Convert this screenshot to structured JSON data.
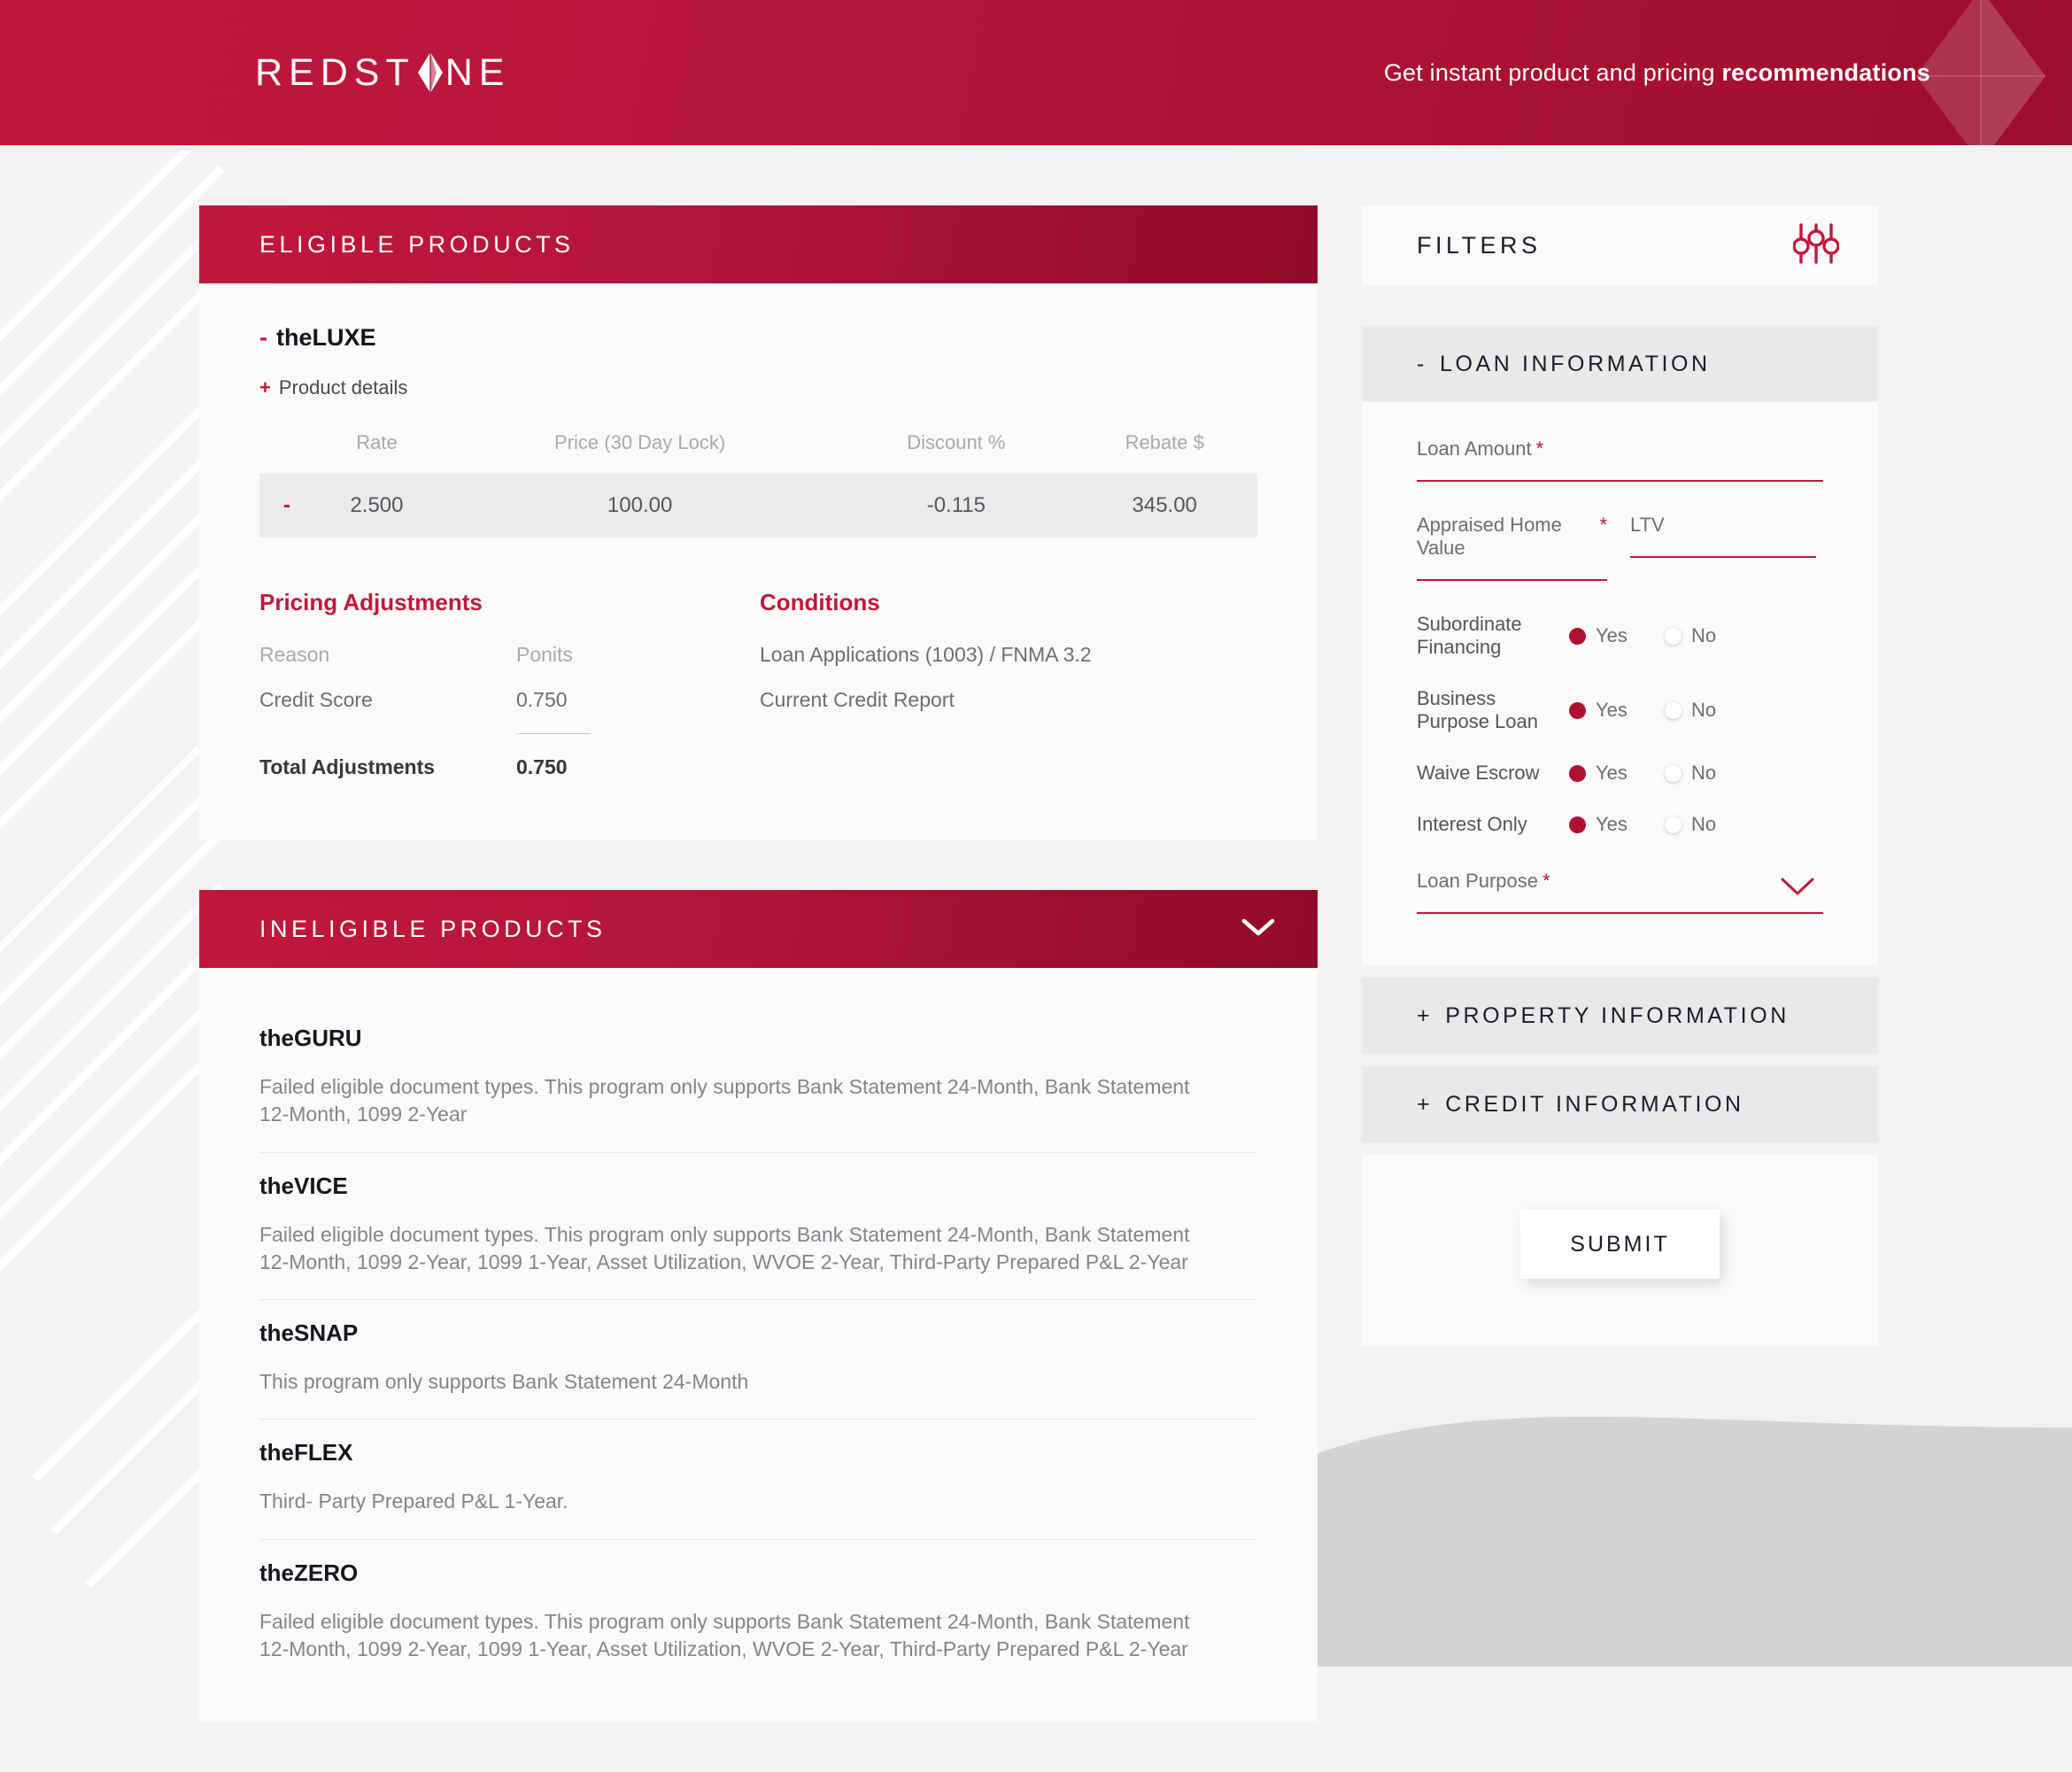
{
  "header": {
    "brand_before": "REDST",
    "brand_after": "NE",
    "brand_diamond_icon": "diamond-icon",
    "tagline_normal": "Get instant product and pricing ",
    "tagline_bold": "recommendations",
    "watermark_icon": "diamond-watermark-icon"
  },
  "eligible": {
    "panel_title": "ELIGIBLE PRODUCTS",
    "product_name": "theLUXE",
    "product_collapse_sign": "-",
    "product_details_sign": "+",
    "product_details_label": "Product details",
    "columns": [
      "Rate",
      "Price (30 Day Lock)",
      "Discount %",
      "Rebate $"
    ],
    "row_toggle_sign": "-",
    "row": {
      "rate": "2.500",
      "price": "100.00",
      "discount": "-0.115",
      "rebate": "345.00"
    },
    "adjustments": {
      "heading": "Pricing Adjustments",
      "col_reason": "Reason",
      "col_points": "Ponits",
      "rows": [
        {
          "reason": "Credit Score",
          "points": "0.750"
        }
      ],
      "total_label": "Total Adjustments",
      "total_value": "0.750"
    },
    "conditions": {
      "heading": "Conditions",
      "items": [
        "Loan Applications (1003) / FNMA 3.2",
        "Current Credit Report"
      ]
    }
  },
  "ineligible": {
    "panel_title": "INELIGIBLE PRODUCTS",
    "chevron_icon": "chevron-down-icon",
    "items": [
      {
        "name": "theGURU",
        "reason": "Failed eligible document types. This program only supports Bank Statement 24-Month, Bank Statement 12-Month, 1099 2-Year"
      },
      {
        "name": "theVICE",
        "reason": "Failed eligible document types. This program only supports Bank Statement 24-Month, Bank Statement 12-Month, 1099 2-Year, 1099 1-Year, Asset Utilization, WVOE 2-Year, Third-Party Prepared P&L 2-Year"
      },
      {
        "name": "theSNAP",
        "reason": "This program only supports Bank Statement 24-Month"
      },
      {
        "name": "theFLEX",
        "reason": "Third- Party Prepared P&L 1-Year."
      },
      {
        "name": "theZERO",
        "reason": "Failed eligible document types. This program only supports Bank Statement 24-Month, Bank Statement 12-Month, 1099 2-Year, 1099 1-Year, Asset Utilization, WVOE 2-Year, Third-Party Prepared P&L 2-Year"
      }
    ]
  },
  "filters": {
    "title": "FILTERS",
    "icon": "sliders-icon",
    "loan_information": {
      "sign": "-",
      "title": "LOAN INFORMATION",
      "loan_amount_label": "Loan Amount",
      "loan_amount_value": "",
      "appraised_label": "Appraised Home Value",
      "appraised_value": "",
      "ltv_label": "LTV",
      "ltv_value": "",
      "required_mark": "*",
      "toggles": [
        {
          "label": "Subordinate Financing",
          "yes": "Yes",
          "no": "No",
          "selected": "Yes"
        },
        {
          "label": "Business Purpose Loan",
          "yes": "Yes",
          "no": "No",
          "selected": "Yes"
        },
        {
          "label": "Waive Escrow",
          "yes": "Yes",
          "no": "No",
          "selected": "Yes"
        },
        {
          "label": "Interest Only",
          "yes": "Yes",
          "no": "No",
          "selected": "Yes"
        }
      ],
      "loan_purpose_label": "Loan Purpose",
      "loan_purpose_value": "",
      "loan_purpose_chevron": "chevron-down-icon"
    },
    "property_information": {
      "sign": "+",
      "title": "PROPERTY INFORMATION"
    },
    "credit_information": {
      "sign": "+",
      "title": "CREDIT INFORMATION"
    },
    "submit_label": "SUBMIT"
  },
  "colors": {
    "brand_red": "#c2173c",
    "brand_dark_red": "#920a27",
    "ink": "#1b1b2b",
    "muted": "#a9a9ae",
    "page_bg": "#f2f2f2"
  }
}
